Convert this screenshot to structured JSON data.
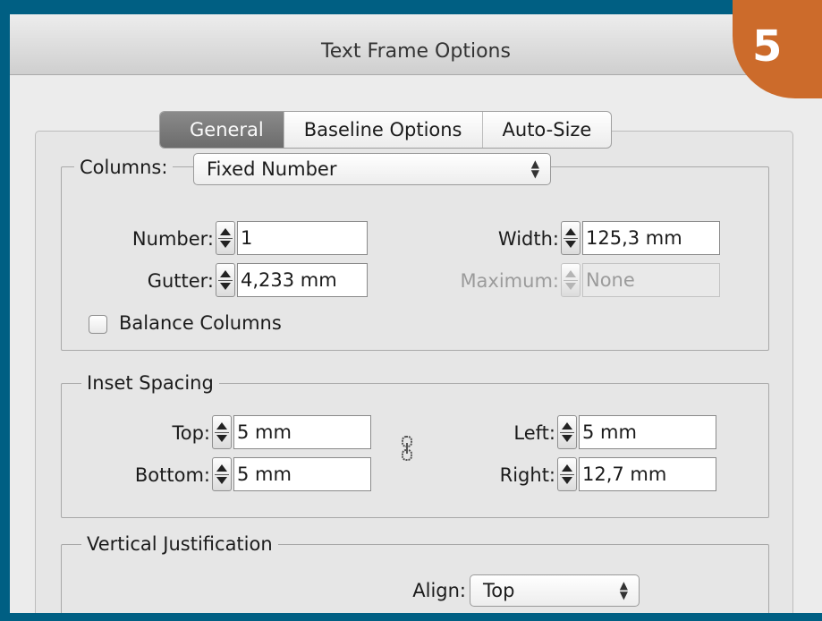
{
  "window": {
    "title": "Text Frame Options"
  },
  "badge": {
    "number": "5"
  },
  "tabs": [
    {
      "label": "General",
      "active": true
    },
    {
      "label": "Baseline Options",
      "active": false
    },
    {
      "label": "Auto-Size",
      "active": false
    }
  ],
  "columns": {
    "label": "Columns:",
    "mode": "Fixed Number",
    "number": {
      "label": "Number:",
      "value": "1"
    },
    "width": {
      "label": "Width:",
      "value": "125,3 mm"
    },
    "gutter": {
      "label": "Gutter:",
      "value": "4,233 mm"
    },
    "maximum": {
      "label": "Maximum:",
      "value": "None",
      "enabled": false
    },
    "balance": {
      "label": "Balance Columns",
      "checked": false
    }
  },
  "inset": {
    "title": "Inset Spacing",
    "top": {
      "label": "Top:",
      "value": "5 mm"
    },
    "bottom": {
      "label": "Bottom:",
      "value": "5 mm"
    },
    "left": {
      "label": "Left:",
      "value": "5 mm"
    },
    "right": {
      "label": "Right:",
      "value": "12,7 mm"
    }
  },
  "vertical": {
    "title": "Vertical Justification",
    "align": {
      "label": "Align:",
      "value": "Top"
    }
  },
  "colors": {
    "frame": "#005f83",
    "badge": "#cc6b2b",
    "tab_active": "#7a7a7a"
  }
}
